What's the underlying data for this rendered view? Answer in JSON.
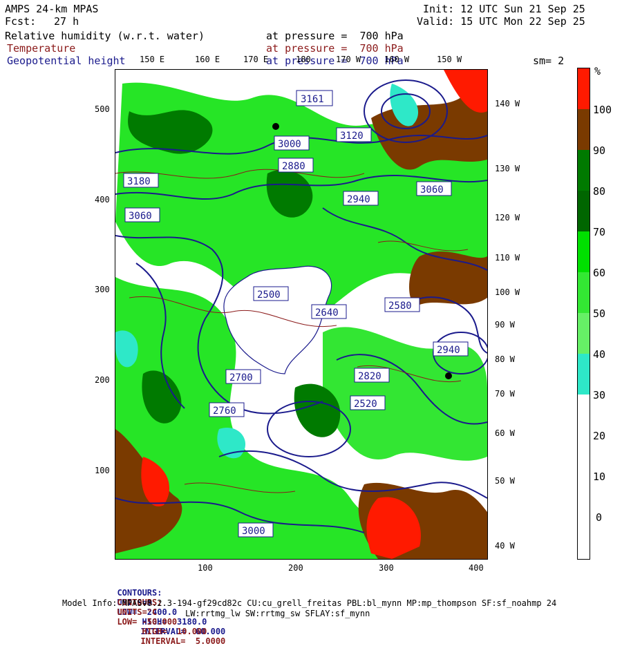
{
  "header": {
    "model": "AMPS 24-km MPAS",
    "fcst_label": "Fcst:",
    "fcst_value": "27 h",
    "init": "Init: 12 UTC Sun 21 Sep 25",
    "valid": "Valid: 15 UTC Mon 22 Sep 25",
    "field1": "Relative humidity (w.r.t. water)",
    "field2": "Temperature",
    "field3": "Geopotential height",
    "pressure1": "at pressure =  700 hPa",
    "pressure2": "at pressure =  700 hPa",
    "pressure3": "at pressure =  700 hPa",
    "smooth": "sm= 2"
  },
  "colors": {
    "rh_white": "#ffffff",
    "rh_cyan": "#2ee8c8",
    "rh_lightgreen": "#66f066",
    "rh_green": "#00e000",
    "rh_darkgreen": "#007a00",
    "rh_brown": "#7a3a00",
    "rh_red": "#ff1a00",
    "temperature_contour": "#8b1a1a",
    "height_contour": "#1a1a8c"
  },
  "top_lon_labels": [
    "150 E",
    "160 E",
    "170 E",
    "180",
    "170 W",
    "160 W",
    "150 W"
  ],
  "right_lon_labels": [
    "140 W",
    "130 W",
    "120 W",
    "110 W",
    "100 W",
    "90 W",
    "80 W",
    "70 W",
    "60 W",
    "50 W",
    "40 W"
  ],
  "left_y_ticks": [
    "500",
    "400",
    "300",
    "200",
    "100"
  ],
  "bottom_x_ticks": [
    "100",
    "200",
    "300",
    "400"
  ],
  "colorbar": {
    "unit": "%",
    "labels": [
      "100",
      "90",
      "80",
      "70",
      "60",
      "50",
      "40",
      "30",
      "20",
      "10",
      "0"
    ]
  },
  "height_labels": [
    "3161",
    "3120",
    "3060",
    "3000",
    "2940",
    "2880",
    "2820",
    "2760",
    "2700",
    "2640",
    "2580",
    "2520",
    "2500",
    "3180",
    "3060",
    "3000",
    "2940"
  ],
  "footer": {
    "line1_lead": "CONTOURS:",
    "line1_units": "UNITS=m",
    "line1_low": "LOW=  2400.0",
    "line1_high": "HIGH=  3180.0",
    "line1_interval": "INTERVAL=  60.000",
    "line2_lead": "CONTOURS:",
    "line2_units": "UNITS=°C",
    "line2_low": "LOW= -50.000",
    "line2_high": "HIGH=  10.000",
    "line2_interval": "INTERVAL=  5.0000",
    "model_info": "Model Info: MPASv8.2.3-194-gf29cd82c CU:cu_grell_freitas PBL:bl_mynn MP:mp_thompson SF:sf_noahmp 24",
    "model_info2": "LW:rrtmg_lw SW:rrtmg_sw SFLAY:sf_mynn"
  }
}
